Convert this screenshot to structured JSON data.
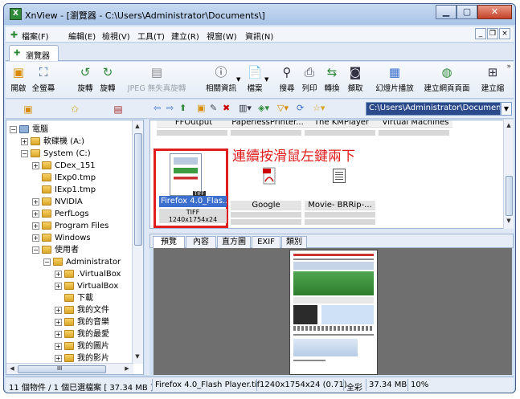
{
  "window": {
    "title": "XnView - [瀏覽器 - C:\\Users\\Administrator\\Documents\\]",
    "controls": {
      "minimize": "▁",
      "maximize": "▢",
      "close": "✕"
    }
  },
  "menu": [
    "檔案(F)",
    "編輯(E)",
    "檢視(V)",
    "工具(T)",
    "建立(R)",
    "視窗(W)",
    "資訊(N)"
  ],
  "mdi": {
    "minimize": "_",
    "restore": "❐",
    "close": "×"
  },
  "doc_tab": {
    "label": "瀏覽器"
  },
  "toolbar": {
    "open": "開啟",
    "fullscreen": "全螢幕",
    "rotate_left": "旋轉",
    "rotate_right": "旋轉",
    "jpeg_lossless": "JPEG 無失真旋轉",
    "related_info": "相關資訊",
    "file": "檔案",
    "search": "搜尋",
    "print": "列印",
    "convert": "轉換",
    "capture": "擷取",
    "slideshow": "幻燈片播放",
    "create_webpage": "建立網頁頁面",
    "create_other": "建立縮"
  },
  "address": {
    "path": "C:\\Users\\Administrator\\Documents\\"
  },
  "tree": [
    {
      "label": "電腦",
      "indent": 0,
      "expander": "−"
    },
    {
      "label": "軟碟機 (A:)",
      "indent": 1,
      "expander": "+"
    },
    {
      "label": "System (C:)",
      "indent": 1,
      "expander": "−"
    },
    {
      "label": "CDex_151",
      "indent": 2,
      "expander": "+"
    },
    {
      "label": "IExp0.tmp",
      "indent": 2,
      "expander": ""
    },
    {
      "label": "IExp1.tmp",
      "indent": 2,
      "expander": ""
    },
    {
      "label": "NVIDIA",
      "indent": 2,
      "expander": "+"
    },
    {
      "label": "PerfLogs",
      "indent": 2,
      "expander": "+"
    },
    {
      "label": "Program Files",
      "indent": 2,
      "expander": "+"
    },
    {
      "label": "Windows",
      "indent": 2,
      "expander": "+"
    },
    {
      "label": "使用者",
      "indent": 2,
      "expander": "−"
    },
    {
      "label": "Administrator",
      "indent": 3,
      "expander": "−"
    },
    {
      "label": ".VirtualBox",
      "indent": 4,
      "expander": "+"
    },
    {
      "label": "VirtualBox",
      "indent": 4,
      "expander": "+"
    },
    {
      "label": "下載",
      "indent": 4,
      "expander": ""
    },
    {
      "label": "我的文件",
      "indent": 4,
      "expander": "+"
    },
    {
      "label": "我的音樂",
      "indent": 4,
      "expander": "+"
    },
    {
      "label": "我的最愛",
      "indent": 4,
      "expander": "+"
    },
    {
      "label": "我的圖片",
      "indent": 4,
      "expander": "+"
    },
    {
      "label": "我的影片",
      "indent": 4,
      "expander": "+"
    }
  ],
  "tree_hscroll_label": "III",
  "browser": {
    "top_captions": [
      "FFOutput",
      "PaperlessPrinter...",
      "The KMPlayer",
      "Virtual Machines"
    ],
    "items": [
      {
        "name": "Firefox 4.0_Flas...",
        "info1": "TIFF",
        "info2": "1240x1754x24"
      },
      {
        "name": "Google"
      },
      {
        "name": "Movie- BRRip-..."
      }
    ],
    "annotation": "連續按滑鼠左鍵兩下",
    "tiff_badge": "TIFF"
  },
  "preview_tabs": [
    "預覽",
    "內容",
    "直方圖",
    "EXIF",
    "類別"
  ],
  "status": {
    "selection": "11 個物件 / 1 個已選檔案 [ 37.34 MB ]",
    "filename": "Firefox 4.0_Flash Player.tif",
    "dimensions": "1240x1754x24 (0.71)",
    "color": "全彩",
    "size": "37.34 MB",
    "zoom": "10%"
  }
}
